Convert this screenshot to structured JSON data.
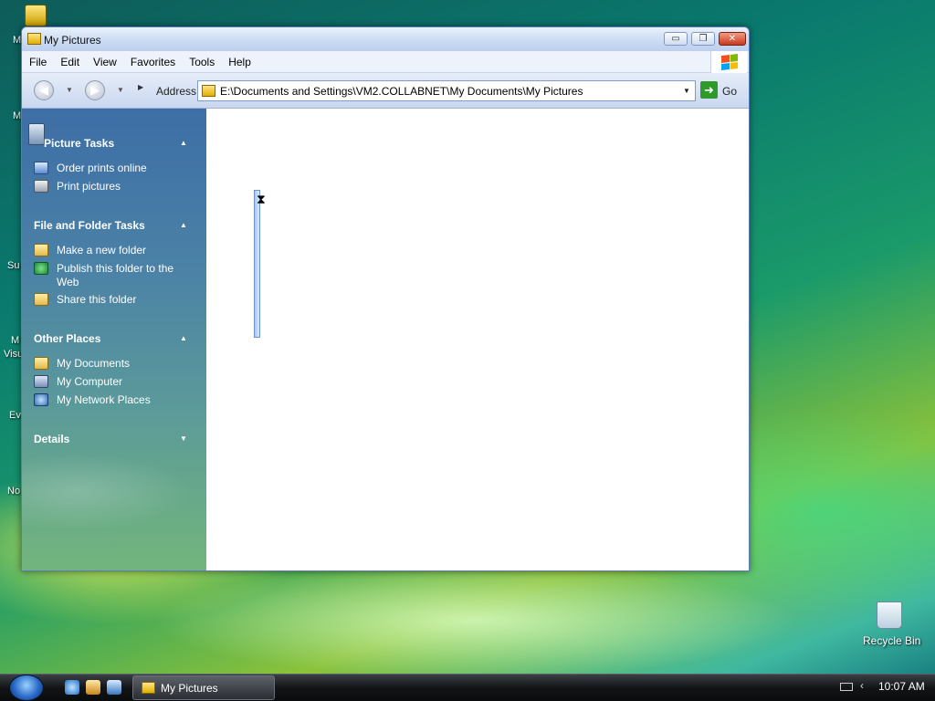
{
  "desktop": {
    "left_labels": [
      "M",
      "M",
      "Su",
      "M",
      "Visu",
      "Ev",
      "No"
    ],
    "recycle_bin_label": "Recycle Bin"
  },
  "window": {
    "title": "My Pictures",
    "controls": {
      "minimize": "▭",
      "maximize": "❐",
      "close": "✕"
    },
    "menu": [
      "File",
      "Edit",
      "View",
      "Favorites",
      "Tools",
      "Help"
    ],
    "toolbar": {
      "address_label": "Address",
      "address_value": "E:\\Documents and Settings\\VM2.COLLABNET\\My Documents\\My Pictures",
      "go_label": "Go"
    },
    "task_pane": {
      "sections": [
        {
          "title": "Picture Tasks",
          "items": [
            "Order prints online",
            "Print pictures"
          ]
        },
        {
          "title": "File and Folder Tasks",
          "items": [
            "Make a new folder",
            "Publish this folder to the Web",
            "Share this folder"
          ]
        },
        {
          "title": "Other Places",
          "items": [
            "My Documents",
            "My Computer",
            "My Network Places"
          ]
        },
        {
          "title": "Details",
          "items": []
        }
      ]
    }
  },
  "taskbar": {
    "task_button_label": "My Pictures",
    "clock": "10:07 AM"
  },
  "colors": {
    "task_pane_top": "#3d6ea6",
    "task_pane_bottom": "#72b57c",
    "close_button": "#c83a1c"
  }
}
